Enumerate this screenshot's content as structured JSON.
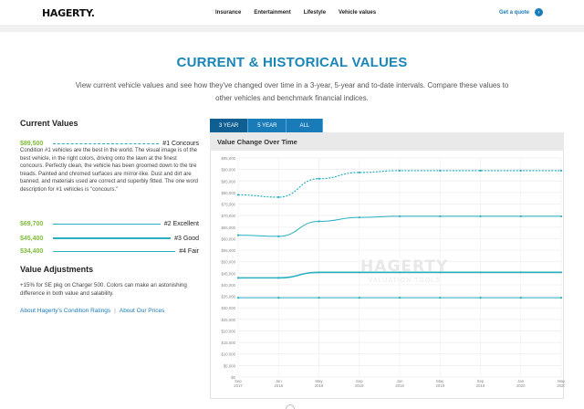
{
  "header": {
    "logo": "HAGERTY.",
    "nav": [
      "Insurance",
      "Entertainment",
      "Lifestyle",
      "Vehicle values"
    ],
    "quote_label": "Get a quote",
    "quote_arrow": "›"
  },
  "page": {
    "title": "CURRENT & HISTORICAL VALUES",
    "subtitle": "View current vehicle values and see how they've changed over time in a 3-year, 5-year and to-date intervals. Compare these values to other vehicles and benchmark financial indices."
  },
  "current_values": {
    "heading": "Current Values",
    "concours": {
      "amount": "$89,500",
      "label": "#1 Concours"
    },
    "description": "Condition #1 vehicles are the best in the world. The visual image is of the best vehicle, in the right colors, driving onto the lawn at the finest concours. Perfectly clean, the vehicle has been groomed down to the tire treads. Painted and chromed surfaces are mirror-like. Dust and dirt are banned, and materials used are correct and superbly fitted. The one word description for #1 vehicles is \"concours.\"",
    "excellent": {
      "amount": "$69,700",
      "label": "#2 Excellent"
    },
    "good": {
      "amount": "$45,400",
      "label": "#3 Good"
    },
    "fair": {
      "amount": "$34,400",
      "label": "#4 Fair"
    }
  },
  "adjustments": {
    "heading": "Value Adjustments",
    "text": "+15% for SE pkg on Charger 500. Colors can make an astonishing difference in both value and salability."
  },
  "links": {
    "ratings": "About Hagerty's Condition Ratings",
    "separator": "|",
    "prices": "About Our Prices"
  },
  "tabs": [
    "3 YEAR",
    "5 YEAR",
    "ALL"
  ],
  "active_tab": "3 YEAR",
  "watermark": {
    "big": "HAGERTY",
    "small": "VALUATION TOOLS"
  },
  "colors": {
    "accent": "#1a7bb9",
    "green": "#7fbf3a",
    "line": "#2aaec0",
    "title": "#1a86b8"
  },
  "chart_data": {
    "type": "line",
    "title": "Value Change Over Time",
    "ylim": [
      0,
      95000
    ],
    "yticks": [
      "$95,000",
      "$90,000",
      "$85,000",
      "$80,000",
      "$75,000",
      "$70,000",
      "$65,000",
      "$60,000",
      "$55,000",
      "$50,000",
      "$45,000",
      "$40,000",
      "$35,000",
      "$30,000",
      "$25,000",
      "$20,000",
      "$15,000",
      "$10,000",
      "$5,000",
      "$0"
    ],
    "categories": [
      "Sep\n2017",
      "Jan\n2018",
      "May\n2018",
      "Sep\n2018",
      "Jan\n2019",
      "May\n2019",
      "Sep\n2019",
      "Jan\n2020",
      "May\n2020"
    ],
    "grid": true,
    "series": [
      {
        "key": "concours",
        "style": "dashed",
        "values": [
          79000,
          78000,
          86000,
          88700,
          89500,
          89500,
          89500,
          89500,
          89500
        ]
      },
      {
        "key": "excellent",
        "style": "solid-thin",
        "values": [
          61500,
          61000,
          67500,
          69200,
          69700,
          69700,
          69700,
          69700,
          69700
        ]
      },
      {
        "key": "good",
        "style": "solid-thick",
        "values": [
          43000,
          43000,
          45400,
          45400,
          45400,
          45400,
          45400,
          45400,
          45400
        ]
      },
      {
        "key": "fair",
        "style": "solid-thin",
        "values": [
          34400,
          34400,
          34400,
          34400,
          34400,
          34400,
          34400,
          34400,
          34400
        ]
      }
    ]
  }
}
